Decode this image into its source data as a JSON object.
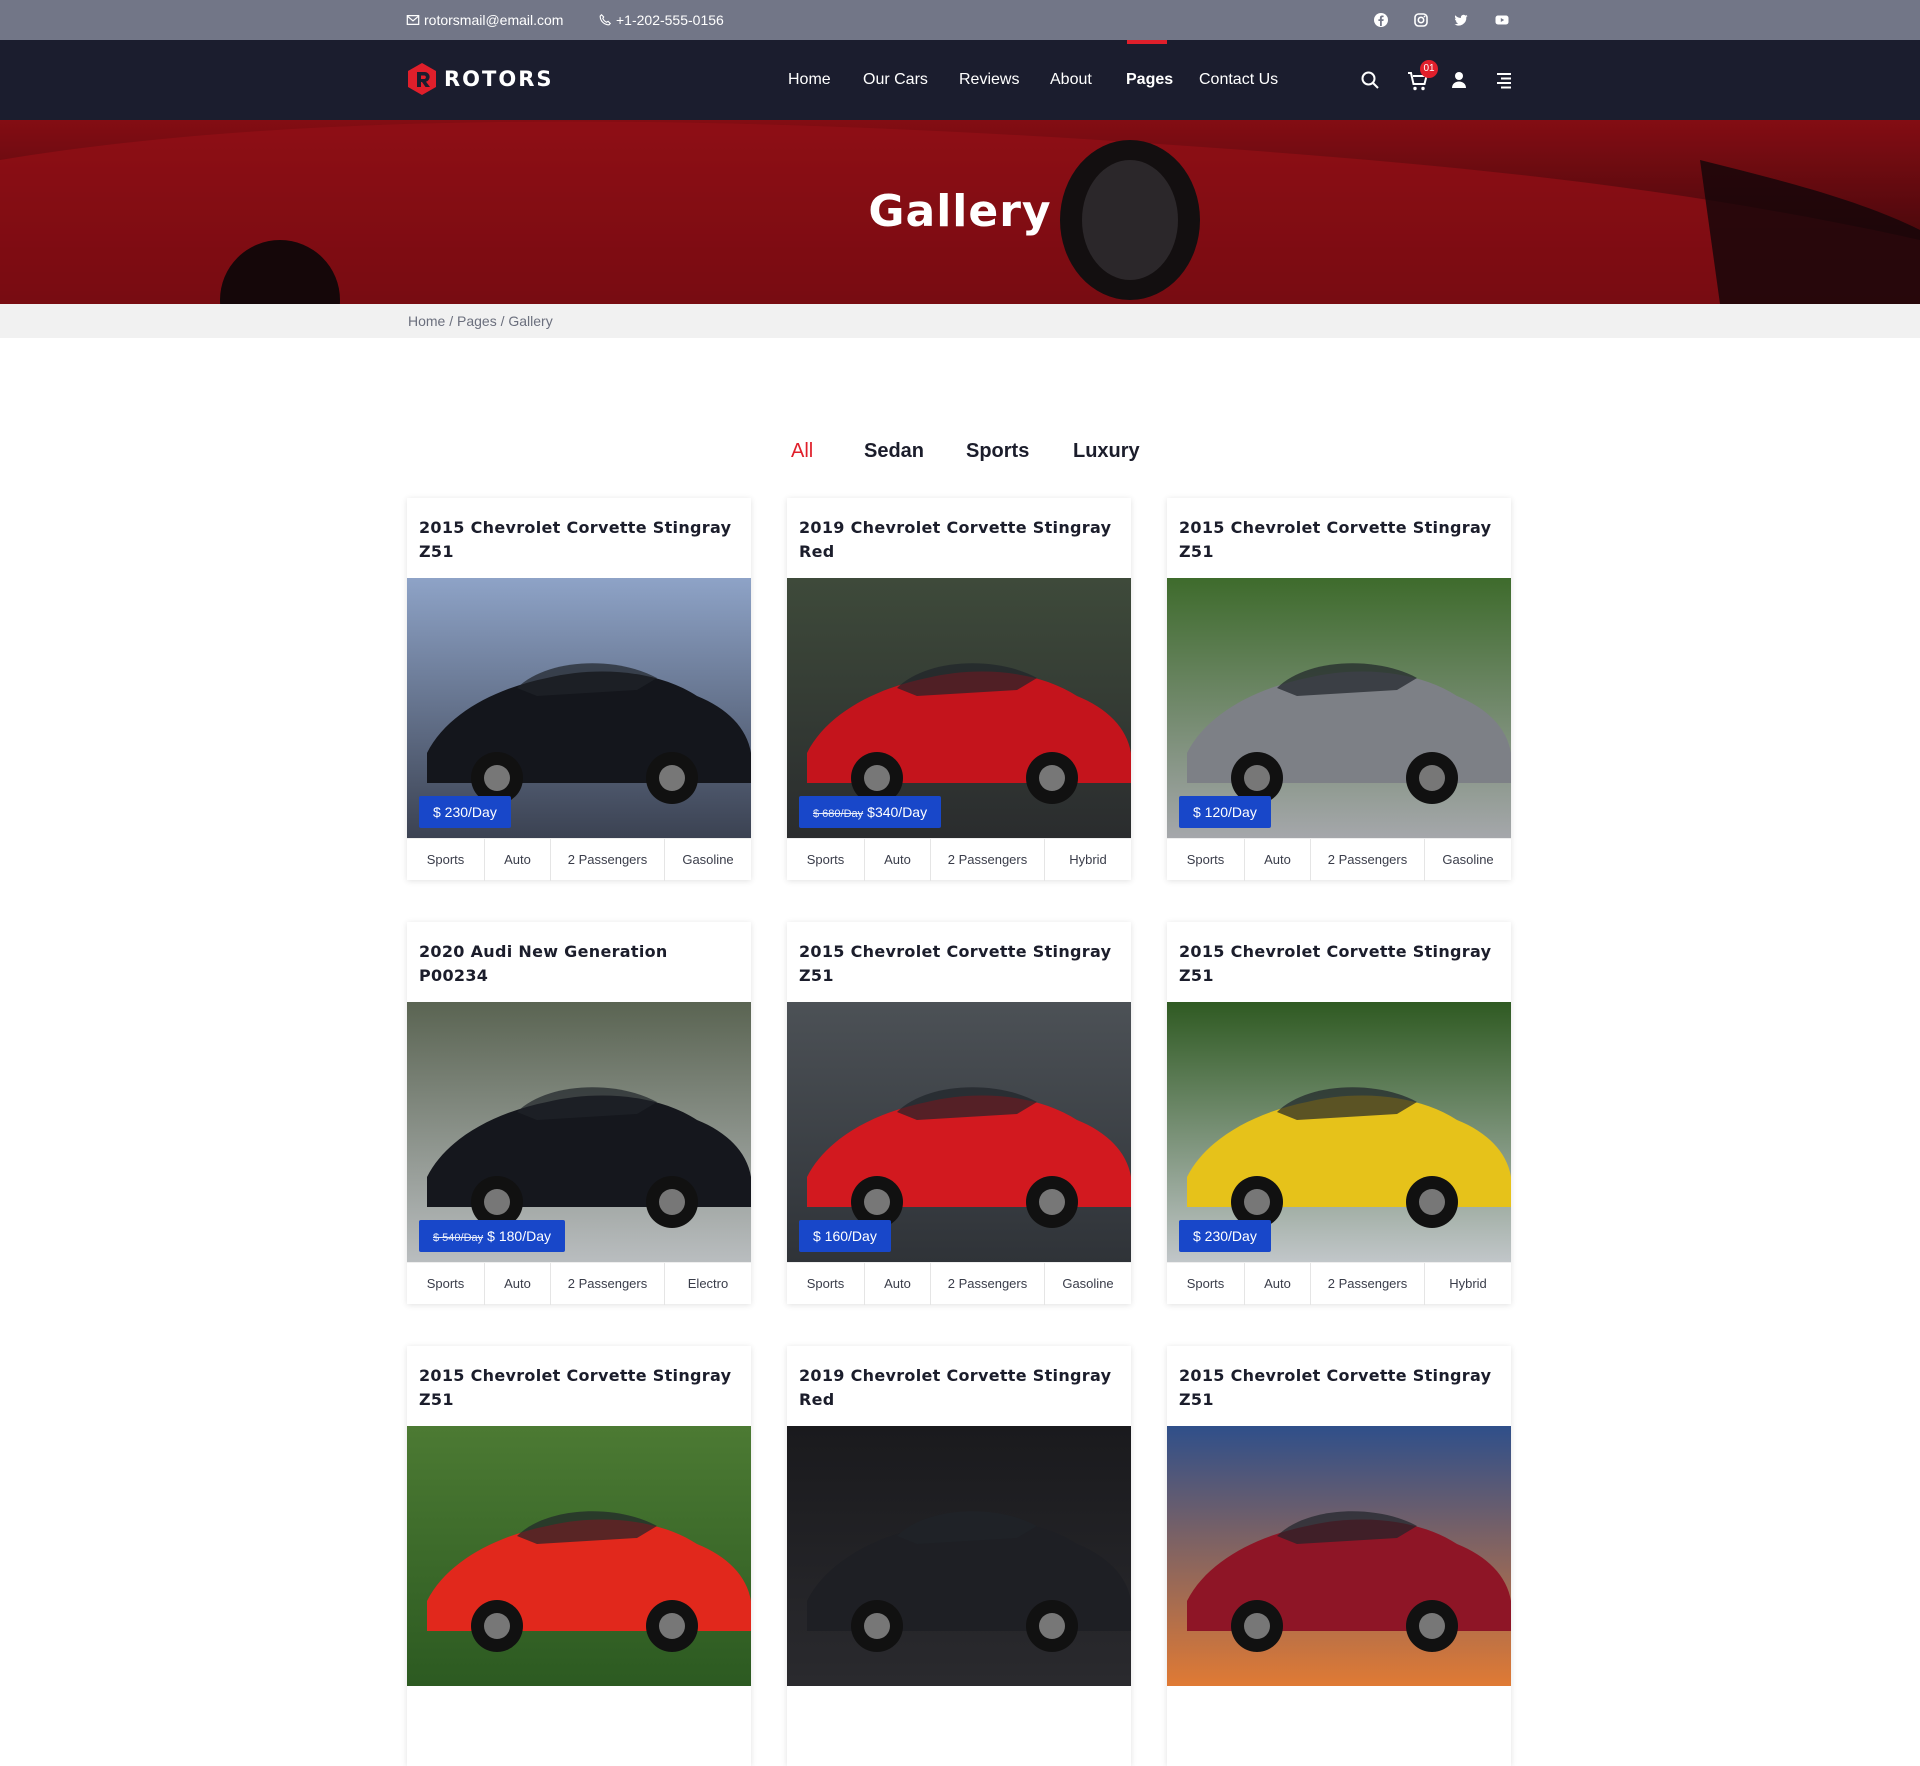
{
  "topbar": {
    "email": "rotorsmail@email.com",
    "phone": "+1-202-555-0156",
    "social": [
      "facebook-icon",
      "instagram-icon",
      "twitter-icon",
      "youtube-icon"
    ]
  },
  "nav": {
    "brand": "ROTORS",
    "items": [
      {
        "label": "Home"
      },
      {
        "label": "Our Cars"
      },
      {
        "label": "Reviews"
      },
      {
        "label": "About"
      },
      {
        "label": "Pages"
      },
      {
        "label": "Contact Us"
      }
    ],
    "active": "Pages",
    "cart_count": "01"
  },
  "hero": {
    "title": "Gallery"
  },
  "breadcrumb": "Home / Pages / Gallery",
  "filters": [
    "All",
    "Sedan",
    "Sports",
    "Luxury"
  ],
  "cards": [
    {
      "title": "2015 Chevrolet Corvette Stingray Z51",
      "old_price": "",
      "price": "$ 230/Day",
      "specs": [
        "Sports",
        "Auto",
        "2 Passengers",
        "Gasoline"
      ],
      "car_color": "#14161c"
    },
    {
      "title": "2019 Chevrolet Corvette Stingray Red",
      "old_price": "$ 680/Day",
      "price": "$340/Day",
      "specs": [
        "Sports",
        "Auto",
        "2 Passengers",
        "Hybrid"
      ],
      "car_color": "#c4141c"
    },
    {
      "title": "2015 Chevrolet Corvette Stingray Z51",
      "old_price": "",
      "price": "$ 120/Day",
      "specs": [
        "Sports",
        "Auto",
        "2 Passengers",
        "Gasoline"
      ],
      "car_color": "#7d8086"
    },
    {
      "title": "2020 Audi New Generation P00234",
      "old_price": "$ 540/Day",
      "price": "$ 180/Day",
      "specs": [
        "Sports",
        "Auto",
        "2 Passengers",
        "Electro"
      ],
      "car_color": "#15171d"
    },
    {
      "title": "2015 Chevrolet Corvette Stingray Z51",
      "old_price": "",
      "price": "$ 160/Day",
      "specs": [
        "Sports",
        "Auto",
        "2 Passengers",
        "Gasoline"
      ],
      "car_color": "#d2191f"
    },
    {
      "title": "2015 Chevrolet Corvette Stingray Z51",
      "old_price": "",
      "price": "$ 230/Day",
      "specs": [
        "Sports",
        "Auto",
        "2 Passengers",
        "Hybrid"
      ],
      "car_color": "#e6c21a"
    },
    {
      "title": "2015 Chevrolet Corvette Stingray Z51",
      "old_price": "",
      "price": "",
      "specs": [],
      "car_color": "#e1281c"
    },
    {
      "title": "2019 Chevrolet Corvette Stingray Red",
      "old_price": "",
      "price": "",
      "specs": [],
      "car_color": "#1e1f24"
    },
    {
      "title": "2015 Chevrolet Corvette Stingray Z51",
      "old_price": "",
      "price": "",
      "specs": [],
      "car_color": "#8e1526"
    }
  ],
  "colors": {
    "accent": "#e01f2b",
    "price_badge": "#1847c9",
    "nav_bg": "#1b1d2e",
    "topbar_bg": "#727687"
  }
}
